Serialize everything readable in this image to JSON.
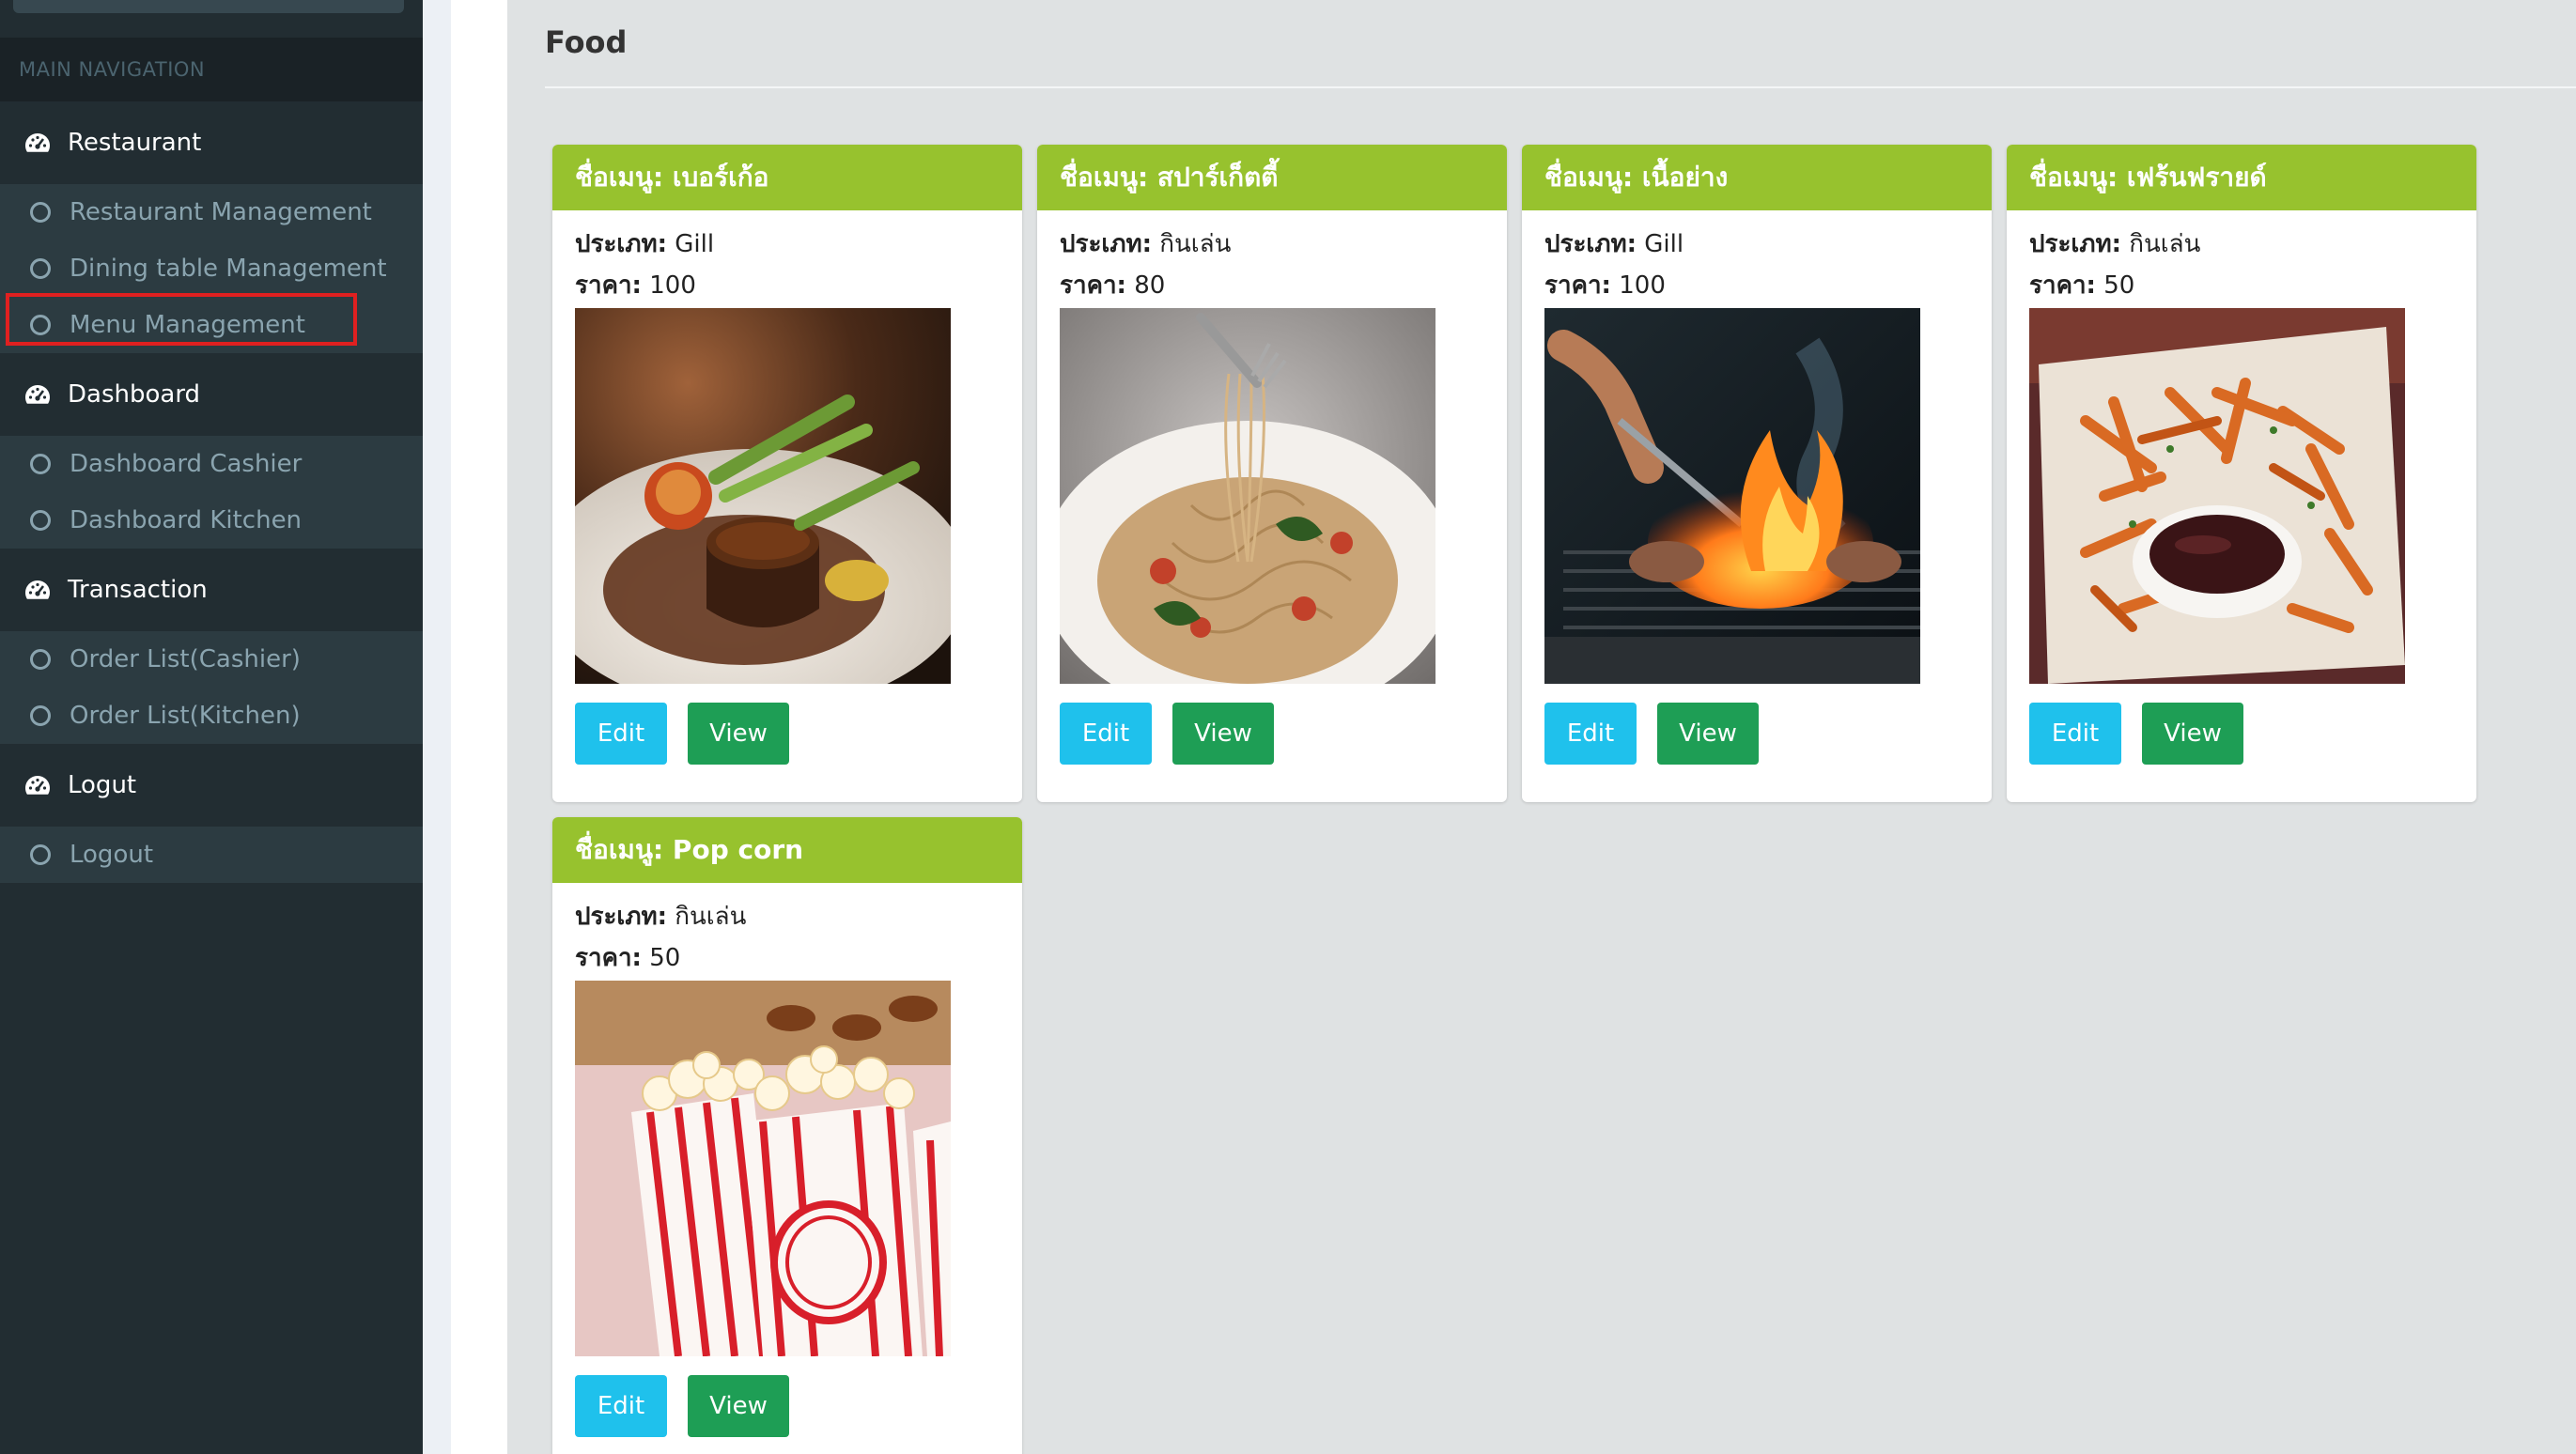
{
  "sidebar": {
    "header": "MAIN NAVIGATION",
    "groups": [
      {
        "label": "Restaurant",
        "items": [
          "Restaurant Management",
          "Dining table Management",
          "Menu Management"
        ]
      },
      {
        "label": "Dashboard",
        "items": [
          "Dashboard Cashier",
          "Dashboard Kitchen"
        ]
      },
      {
        "label": "Transaction",
        "items": [
          "Order List(Cashier)",
          "Order List(Kitchen)"
        ]
      },
      {
        "label": "Logut",
        "items": [
          "Logout"
        ]
      }
    ],
    "highlighted_item": "Menu Management",
    "group_icon": "dashboard-gauge-icon",
    "item_icon": "circle-outline-icon"
  },
  "page": {
    "title": "Food"
  },
  "labels": {
    "name_prefix": "ชื่อเมนู: ",
    "type_label": "ประเภท:",
    "price_label": "ราคา:",
    "edit": "Edit",
    "view": "View"
  },
  "menu_items": [
    {
      "name": "ชื่อเมนู: เบอร์เก้อ",
      "type": " Gill",
      "price": " 100",
      "image": "steak-photo"
    },
    {
      "name": "ชื่อเมนู: สปาร์เก็ตตี้",
      "type": " กินเล่น",
      "price": " 80",
      "image": "spaghetti-photo"
    },
    {
      "name": "ชื่อเมนู: เนื้อย่าง",
      "type": " Gill",
      "price": " 100",
      "image": "grill-photo"
    },
    {
      "name": "ชื่อเมนู: เฟร้นฟรายด์",
      "type": " กินเล่น",
      "price": " 50",
      "image": "fries-photo"
    },
    {
      "name": "ชื่อเมนู: Pop corn",
      "type": " กินเล่น",
      "price": " 50",
      "image": "popcorn-photo"
    }
  ],
  "colors": {
    "sidebar_bg": "#222d32",
    "card_header": "#97c22e",
    "edit_button": "#1fc1ec",
    "view_button": "#1e9e55",
    "highlight": "#e02020"
  }
}
